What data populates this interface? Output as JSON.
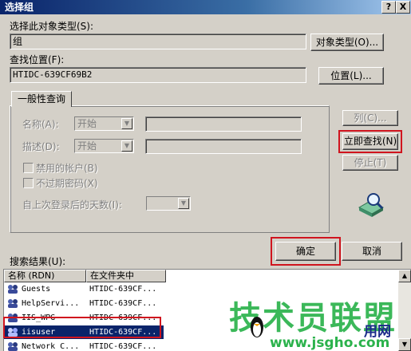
{
  "window": {
    "title": "选择组",
    "help_btn": "?",
    "close_btn": "X"
  },
  "object_type": {
    "label": "选择此对象类型(S):",
    "value": "组",
    "button": "对象类型(O)..."
  },
  "location": {
    "label": "查找位置(F):",
    "value": "HTIDC-639CF69B2",
    "button": "位置(L)..."
  },
  "tab": {
    "label": "一般性查询"
  },
  "query": {
    "name_label": "名称(A):",
    "name_mode": "开始",
    "desc_label": "描述(D):",
    "desc_mode": "开始",
    "disabled_accounts": "禁用的帐户(B)",
    "nonexpiring_pw": "不过期密码(X)",
    "days_since_logon": "自上次登录后的天数(I):"
  },
  "side_buttons": {
    "columns": "列(C)...",
    "find_now": "立即查找(N)",
    "stop": "停止(T)"
  },
  "ok_button": "确定",
  "cancel_button": "取消",
  "results": {
    "label": "搜索结果(U):",
    "columns": [
      "名称 (RDN)",
      "在文件夹中"
    ],
    "rows": [
      {
        "name": "Guests",
        "folder": "HTIDC-639CF...",
        "selected": false
      },
      {
        "name": "HelpServi...",
        "folder": "HTIDC-639CF...",
        "selected": false
      },
      {
        "name": "IIS_WPG",
        "folder": "HTIDC-639CF...",
        "selected": false
      },
      {
        "name": "iisuser",
        "folder": "HTIDC-639CF...",
        "selected": true
      },
      {
        "name": "Network C...",
        "folder": "HTIDC-639CF...",
        "selected": false
      }
    ]
  },
  "watermark": {
    "line1": "技术员联盟",
    "line2": "www.jsgho.com",
    "brand": "用网"
  },
  "colors": {
    "highlight": "#d0141e",
    "selection": "#0a246a",
    "face": "#d4d0c8",
    "watermark_green": "#2bb24c"
  }
}
